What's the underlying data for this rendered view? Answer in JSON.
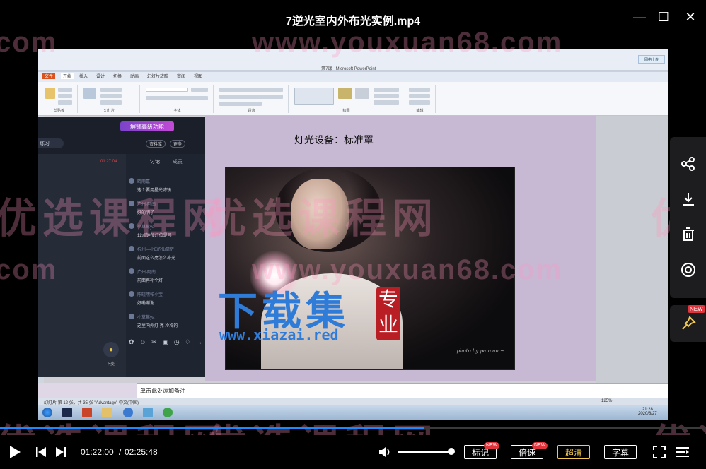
{
  "window": {
    "title": "7逆光室内外布光实例.mp4",
    "minimize_icon": "minimize-icon",
    "maximize_icon": "maximize-icon",
    "close_icon": "close-icon"
  },
  "ppt": {
    "window_title": "第7课 - Microsoft PowerPoint",
    "tabs": [
      "文件",
      "开始",
      "插入",
      "设计",
      "切换",
      "动画",
      "幻灯片放映",
      "审阅",
      "视图"
    ],
    "ribbon_groups": [
      "剪贴板",
      "幻灯片",
      "字体",
      "段落",
      "绘图",
      "编辑"
    ],
    "upload_label": "网络上传",
    "slide_heading": "灯光设备：标准罩",
    "photo_signature": "photo by panpan ~",
    "notes_placeholder": "单击此处添加备注",
    "status_text": "幻灯片 第 12 张，共 35 张   \"Advantage\"   中文(中国)",
    "zoom": "125%",
    "clock_time": "21:28",
    "clock_date": "2020/8/27"
  },
  "chat": {
    "promo": "解锁高级功能",
    "room_label": "练习",
    "btn_library": "资料库",
    "btn_more": "更多",
    "timer": "01:27:04",
    "tab_discuss": "讨论",
    "tab_members": "成员",
    "messages": [
      {
        "user": "晓雨嘉",
        "text": "这个要用星光滤镜"
      },
      {
        "user": "广州-阿南",
        "text": "好的明了"
      },
      {
        "user": "小草莓ya",
        "text": "12点钟加灯位是吗"
      },
      {
        "user": "杭州—小E的仙掌萨",
        "text": "前面这么亮怎么补光"
      },
      {
        "user": "广州-阿南",
        "text": "前面再补个灯"
      },
      {
        "user": "陈晓嘿帕小宝",
        "text": "好嘞谢谢"
      },
      {
        "user": "小草莓ya",
        "text": "这里内外灯 亮 冷冷的"
      }
    ],
    "mic_label": "下麦"
  },
  "watermarks": {
    "brand_cn": "优选课程网",
    "brand_url": "www.youxuan68.com",
    "dot_com": ".com",
    "xiazai_cn": "下载集",
    "xiazai_url": "www.xiazai.red",
    "seal_top": "专",
    "seal_bottom": "业"
  },
  "side_panel": {
    "icons": [
      "share-icon",
      "download-icon",
      "delete-icon",
      "record-icon",
      "pin-icon"
    ],
    "pin_badge": "NEW"
  },
  "player": {
    "progress": 0.6,
    "volume": 1.0,
    "time_current": "01:22:00",
    "time_separator": "/",
    "time_total": "02:25:48",
    "btn_mark": "标记",
    "btn_speed": "倍速",
    "btn_quality": "超清",
    "btn_subtitle": "字幕",
    "badge_new": "NEW",
    "accent_color": "#1e88ff",
    "quality_color": "#f2c94c"
  }
}
